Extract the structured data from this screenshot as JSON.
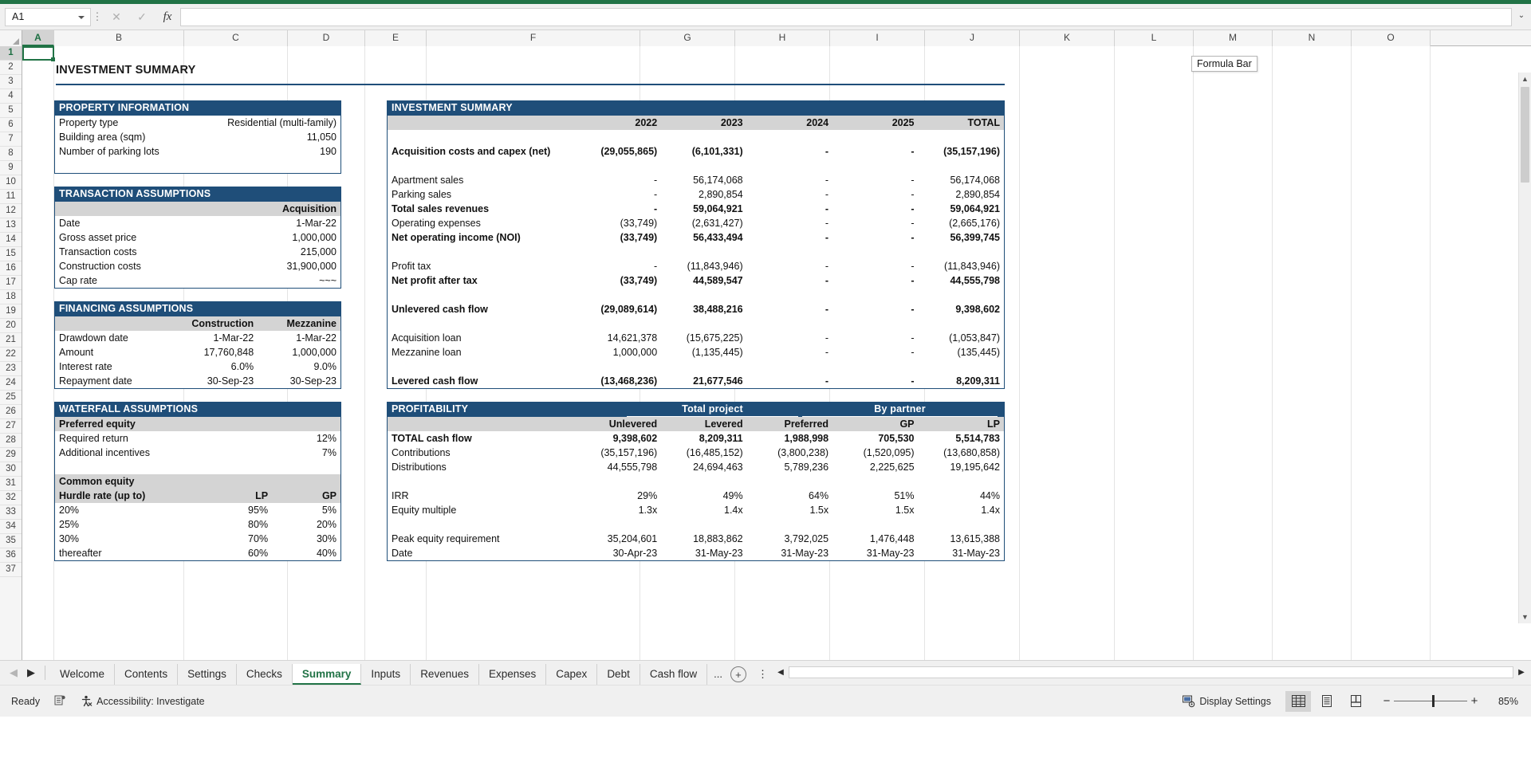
{
  "app": {
    "name_box": "A1",
    "formula_value": "",
    "formula_bar_tooltip": "Formula Bar",
    "column_headers": [
      "A",
      "B",
      "C",
      "D",
      "E",
      "F",
      "G",
      "H",
      "I",
      "J",
      "K",
      "L",
      "M",
      "N",
      "O"
    ],
    "selected_column": "A",
    "selected_row": "1",
    "row_numbers": [
      "1",
      "2",
      "3",
      "4",
      "5",
      "6",
      "7",
      "8",
      "9",
      "10",
      "11",
      "12",
      "13",
      "14",
      "15",
      "16",
      "17",
      "18",
      "19",
      "20",
      "21",
      "22",
      "23",
      "24",
      "25",
      "26",
      "27",
      "28",
      "29",
      "30",
      "31",
      "32",
      "33",
      "34",
      "35",
      "36",
      "37"
    ],
    "icons": {
      "cancel": "close-icon",
      "confirm": "check-icon",
      "function": "fx-icon",
      "namebox_caret": "chevron-down-icon"
    }
  },
  "page_title": "INVESTMENT SUMMARY",
  "property_information": {
    "header": "PROPERTY INFORMATION",
    "rows": [
      {
        "label": "Property type",
        "value": "Residential (multi-family)"
      },
      {
        "label": "Building area (sqm)",
        "value": "11,050"
      },
      {
        "label": "Number of parking lots",
        "value": "190"
      }
    ]
  },
  "transaction_assumptions": {
    "header": "TRANSACTION ASSUMPTIONS",
    "column_header": "Acquisition",
    "rows": [
      {
        "label": "Date",
        "value": "1-Mar-22"
      },
      {
        "label": "Gross asset price",
        "value": "1,000,000"
      },
      {
        "label": "Transaction costs",
        "value": "215,000"
      },
      {
        "label": "Construction costs",
        "value": "31,900,000"
      },
      {
        "label": "Cap rate",
        "value": "~~~"
      }
    ]
  },
  "financing_assumptions": {
    "header": "FINANCING ASSUMPTIONS",
    "columns": [
      "Construction",
      "Mezzanine"
    ],
    "rows": [
      {
        "label": "Drawdown date",
        "values": [
          "1-Mar-22",
          "1-Mar-22"
        ]
      },
      {
        "label": "Amount",
        "values": [
          "17,760,848",
          "1,000,000"
        ]
      },
      {
        "label": "Interest rate",
        "values": [
          "6.0%",
          "9.0%"
        ]
      },
      {
        "label": "Repayment date",
        "values": [
          "30-Sep-23",
          "30-Sep-23"
        ]
      }
    ]
  },
  "waterfall_assumptions": {
    "header": "WATERFALL ASSUMPTIONS",
    "preferred_equity_label": "Preferred equity",
    "preferred_rows": [
      {
        "label": "Required return",
        "value": "12%"
      },
      {
        "label": "Additional incentives",
        "value": "7%"
      }
    ],
    "common_equity_label": "Common equity",
    "hurdle_header": {
      "label": "Hurdle rate (up to)",
      "lp": "LP",
      "gp": "GP"
    },
    "hurdle_rows": [
      {
        "label": "20%",
        "lp": "95%",
        "gp": "5%"
      },
      {
        "label": "25%",
        "lp": "80%",
        "gp": "20%"
      },
      {
        "label": "30%",
        "lp": "70%",
        "gp": "30%"
      },
      {
        "label": "thereafter",
        "lp": "60%",
        "gp": "40%"
      }
    ]
  },
  "investment_summary": {
    "header": "INVESTMENT SUMMARY",
    "columns": [
      "2022",
      "2023",
      "2024",
      "2025",
      "TOTAL"
    ],
    "rows": [
      {
        "label": "Acquisition costs and capex (net)",
        "style": "bold",
        "values": [
          "(29,055,865)",
          "(6,101,331)",
          "-",
          "-",
          "(35,157,196)"
        ]
      },
      {
        "label": "",
        "style": "spacer",
        "values": [
          "",
          "",
          "",
          "",
          ""
        ]
      },
      {
        "label": "Apartment sales",
        "style": "indent",
        "values": [
          "-",
          "56,174,068",
          "-",
          "-",
          "56,174,068"
        ]
      },
      {
        "label": "Parking sales",
        "style": "indent",
        "values": [
          "-",
          "2,890,854",
          "-",
          "-",
          "2,890,854"
        ]
      },
      {
        "label": "Total sales revenues",
        "style": "bold",
        "values": [
          "-",
          "59,064,921",
          "-",
          "-",
          "59,064,921"
        ]
      },
      {
        "label": "Operating expenses",
        "style": "indent",
        "values": [
          "(33,749)",
          "(2,631,427)",
          "-",
          "-",
          "(2,665,176)"
        ]
      },
      {
        "label": "Net operating income (NOI)",
        "style": "bold",
        "values": [
          "(33,749)",
          "56,433,494",
          "-",
          "-",
          "56,399,745"
        ]
      },
      {
        "label": "",
        "style": "spacer",
        "values": [
          "",
          "",
          "",
          "",
          ""
        ]
      },
      {
        "label": "Profit tax",
        "style": "indent",
        "values": [
          "-",
          "(11,843,946)",
          "-",
          "-",
          "(11,843,946)"
        ]
      },
      {
        "label": "Net profit after tax",
        "style": "bold",
        "values": [
          "(33,749)",
          "44,589,547",
          "-",
          "-",
          "44,555,798"
        ]
      },
      {
        "label": "",
        "style": "spacer",
        "values": [
          "",
          "",
          "",
          "",
          ""
        ]
      },
      {
        "label": "Unlevered cash flow",
        "style": "bold",
        "values": [
          "(29,089,614)",
          "38,488,216",
          "-",
          "-",
          "9,398,602"
        ]
      },
      {
        "label": "",
        "style": "spacer",
        "values": [
          "",
          "",
          "",
          "",
          ""
        ]
      },
      {
        "label": "Acquisition loan",
        "style": "indent",
        "values": [
          "14,621,378",
          "(15,675,225)",
          "-",
          "-",
          "(1,053,847)"
        ]
      },
      {
        "label": "Mezzanine loan",
        "style": "indent",
        "values": [
          "1,000,000",
          "(1,135,445)",
          "-",
          "-",
          "(135,445)"
        ]
      },
      {
        "label": "",
        "style": "spacer",
        "values": [
          "",
          "",
          "",
          "",
          ""
        ]
      },
      {
        "label": "Levered cash flow",
        "style": "bold",
        "values": [
          "(13,468,236)",
          "21,677,546",
          "-",
          "-",
          "8,209,311"
        ]
      }
    ]
  },
  "profitability": {
    "header": "PROFITABILITY",
    "group_headers": [
      {
        "label": "Total project",
        "span": 2
      },
      {
        "label": "By partner",
        "span": 3
      }
    ],
    "columns": [
      "Unlevered",
      "Levered",
      "Preferred",
      "GP",
      "LP"
    ],
    "rows": [
      {
        "label": "TOTAL cash flow",
        "style": "bold",
        "values": [
          "9,398,602",
          "8,209,311",
          "1,988,998",
          "705,530",
          "5,514,783"
        ]
      },
      {
        "label": "Contributions",
        "style": "indent",
        "values": [
          "(35,157,196)",
          "(16,485,152)",
          "(3,800,238)",
          "(1,520,095)",
          "(13,680,858)"
        ]
      },
      {
        "label": "Distributions",
        "style": "indent",
        "values": [
          "44,555,798",
          "24,694,463",
          "5,789,236",
          "2,225,625",
          "19,195,642"
        ]
      },
      {
        "label": "",
        "style": "spacer",
        "values": [
          "",
          "",
          "",
          "",
          ""
        ]
      },
      {
        "label": "IRR",
        "style": "plain",
        "values": [
          "29%",
          "49%",
          "64%",
          "51%",
          "44%"
        ]
      },
      {
        "label": "Equity multiple",
        "style": "plain",
        "values": [
          "1.3x",
          "1.4x",
          "1.5x",
          "1.5x",
          "1.4x"
        ]
      },
      {
        "label": "",
        "style": "spacer",
        "values": [
          "",
          "",
          "",
          "",
          ""
        ]
      },
      {
        "label": "Peak equity requirement",
        "style": "plain",
        "values": [
          "35,204,601",
          "18,883,862",
          "3,792,025",
          "1,476,448",
          "13,615,388"
        ]
      },
      {
        "label": "Date",
        "style": "indent",
        "values": [
          "30-Apr-23",
          "31-May-23",
          "31-May-23",
          "31-May-23",
          "31-May-23"
        ]
      }
    ]
  },
  "sheet_tabs": {
    "items": [
      "Welcome",
      "Contents",
      "Settings",
      "Checks",
      "Summary",
      "Inputs",
      "Revenues",
      "Expenses",
      "Capex",
      "Debt",
      "Cash flow"
    ],
    "active": "Summary",
    "overflow": "...",
    "add_label": "+"
  },
  "status_bar": {
    "state": "Ready",
    "accessibility": "Accessibility: Investigate",
    "display_settings": "Display Settings",
    "zoom": "85%",
    "views": [
      "normal-view",
      "page-layout-view",
      "page-break-view"
    ]
  }
}
